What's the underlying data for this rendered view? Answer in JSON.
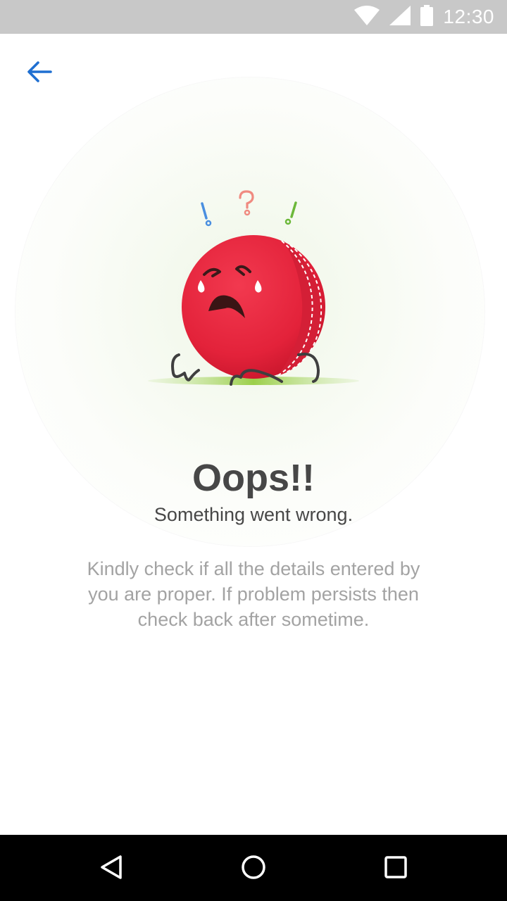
{
  "status_bar": {
    "time": "12:30",
    "icons": [
      "wifi-icon",
      "cellular-signal-icon",
      "battery-icon"
    ]
  },
  "header": {
    "back_icon": "arrow-back-icon"
  },
  "illustration": {
    "description_icon": "sad-cricket-ball-icon",
    "marks": [
      "!",
      "?",
      "!"
    ]
  },
  "error": {
    "title": "Oops!!",
    "subtitle": "Something went wrong.",
    "message": "Kindly check if all the details entered by you are proper. If problem persists then check back after sometime."
  },
  "nav_bar": {
    "back": "nav-back-icon",
    "home": "nav-home-icon",
    "recents": "nav-recents-icon"
  },
  "colors": {
    "accent": "#1f6fd1",
    "ball": "#e8283d",
    "ground": "#9bcf4a",
    "text_dark": "#474747",
    "text_muted": "#a3a3a3",
    "status_bar": "#c8c8c8"
  }
}
